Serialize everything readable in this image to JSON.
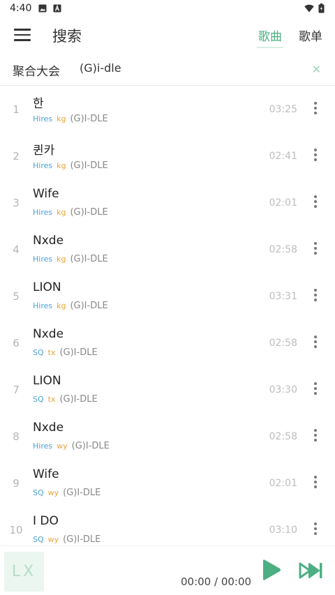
{
  "status_bar": {
    "time": "4:40",
    "icons": [
      "image-icon",
      "font-a-icon",
      "wifi-icon",
      "battery-icon"
    ]
  },
  "header": {
    "title": "搜索",
    "tabs": [
      {
        "label": "歌曲",
        "active": true
      },
      {
        "label": "歌单",
        "active": false
      }
    ],
    "accent_color": "#4caf83"
  },
  "search": {
    "source": "聚合大会",
    "query": "(G)i-dle",
    "clear_icon": "close-icon"
  },
  "songs": [
    {
      "index": "1",
      "name": "한",
      "quality": "Hires",
      "source": "kg",
      "artist": "(G)I-DLE",
      "duration": "03:25"
    },
    {
      "index": "2",
      "name": "퀸카",
      "quality": "Hires",
      "source": "kg",
      "artist": "(G)I-DLE",
      "duration": "02:41"
    },
    {
      "index": "3",
      "name": "Wife",
      "quality": "Hires",
      "source": "kg",
      "artist": "(G)I-DLE",
      "duration": "02:01"
    },
    {
      "index": "4",
      "name": "Nxde",
      "quality": "Hires",
      "source": "kg",
      "artist": "(G)I-DLE",
      "duration": "02:58"
    },
    {
      "index": "5",
      "name": "LION",
      "quality": "Hires",
      "source": "kg",
      "artist": "(G)I-DLE",
      "duration": "03:31"
    },
    {
      "index": "6",
      "name": "Nxde",
      "quality": "SQ",
      "source": "tx",
      "artist": "(G)I-DLE",
      "duration": "02:58"
    },
    {
      "index": "7",
      "name": "LION",
      "quality": "SQ",
      "source": "tx",
      "artist": "(G)I-DLE",
      "duration": "03:30"
    },
    {
      "index": "8",
      "name": "Nxde",
      "quality": "Hires",
      "source": "wy",
      "artist": "(G)I-DLE",
      "duration": "02:58"
    },
    {
      "index": "9",
      "name": "Wife",
      "quality": "SQ",
      "source": "wy",
      "artist": "(G)I-DLE",
      "duration": "02:01"
    },
    {
      "index": "10",
      "name": "I DO",
      "quality": "SQ",
      "source": "wy",
      "artist": "(G)I-DLE",
      "duration": "03:10"
    }
  ],
  "player": {
    "cover_text": "LX",
    "time": "00:00 / 00:00",
    "play_icon": "play-icon",
    "next_icon": "skip-next-icon",
    "button_color": "#4caf83"
  }
}
